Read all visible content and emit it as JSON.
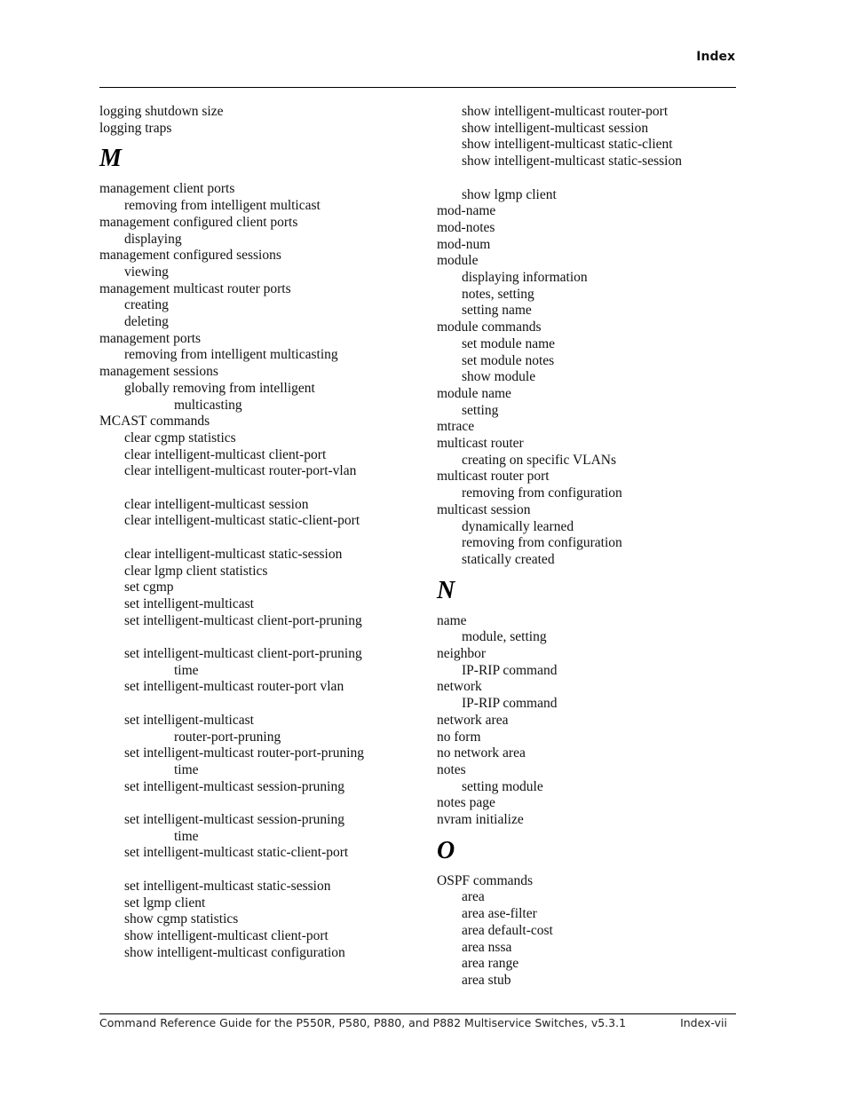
{
  "header": {
    "section_title": "Index"
  },
  "footer": {
    "guide_title": "Command Reference Guide for the P550R, P580, P880, and P882 Multiservice Switches, v5.3.1",
    "page_number": "Index-vii"
  },
  "left_column": [
    {
      "type": "entry",
      "level": 0,
      "text": "logging shutdown size"
    },
    {
      "type": "entry",
      "level": 0,
      "text": "logging traps"
    },
    {
      "type": "letter",
      "text": "M"
    },
    {
      "type": "entry",
      "level": 0,
      "text": "management client ports"
    },
    {
      "type": "entry",
      "level": 1,
      "text": "removing from intelligent multicast"
    },
    {
      "type": "entry",
      "level": 0,
      "text": "management configured client ports"
    },
    {
      "type": "entry",
      "level": 1,
      "text": "displaying"
    },
    {
      "type": "entry",
      "level": 0,
      "text": "management configured sessions"
    },
    {
      "type": "entry",
      "level": 1,
      "text": "viewing"
    },
    {
      "type": "entry",
      "level": 0,
      "text": "management multicast router ports"
    },
    {
      "type": "entry",
      "level": 1,
      "text": "creating"
    },
    {
      "type": "entry",
      "level": 1,
      "text": "deleting"
    },
    {
      "type": "entry",
      "level": 0,
      "text": "management ports"
    },
    {
      "type": "entry",
      "level": 1,
      "text": "removing from intelligent multicasting"
    },
    {
      "type": "entry",
      "level": 0,
      "text": "management sessions"
    },
    {
      "type": "entry",
      "level": 1,
      "text": "globally removing from intelligent"
    },
    {
      "type": "entry",
      "level": 2,
      "text": "multicasting"
    },
    {
      "type": "entry",
      "level": 0,
      "text": "MCAST commands"
    },
    {
      "type": "entry",
      "level": 1,
      "text": "clear cgmp statistics"
    },
    {
      "type": "entry",
      "level": 1,
      "text": "clear intelligent-multicast client-port"
    },
    {
      "type": "entry",
      "level": 1,
      "text": "clear intelligent-multicast router-port-vlan"
    },
    {
      "type": "blank"
    },
    {
      "type": "entry",
      "level": 1,
      "text": "clear intelligent-multicast session"
    },
    {
      "type": "entry",
      "level": 1,
      "text": "clear intelligent-multicast static-client-port"
    },
    {
      "type": "blank"
    },
    {
      "type": "entry",
      "level": 1,
      "text": "clear intelligent-multicast static-session"
    },
    {
      "type": "entry",
      "level": 1,
      "text": "clear lgmp client statistics"
    },
    {
      "type": "entry",
      "level": 1,
      "text": "set cgmp"
    },
    {
      "type": "entry",
      "level": 1,
      "text": "set intelligent-multicast"
    },
    {
      "type": "entry",
      "level": 1,
      "text": "set intelligent-multicast client-port-pruning"
    },
    {
      "type": "blank"
    },
    {
      "type": "entry",
      "level": 1,
      "text": "set intelligent-multicast client-port-pruning"
    },
    {
      "type": "entry",
      "level": 2,
      "text": "time"
    },
    {
      "type": "entry",
      "level": 1,
      "text": "set intelligent-multicast router-port vlan"
    },
    {
      "type": "blank"
    },
    {
      "type": "entry",
      "level": 1,
      "text": "set intelligent-multicast"
    },
    {
      "type": "entry",
      "level": 2,
      "text": "router-port-pruning"
    },
    {
      "type": "entry",
      "level": 1,
      "text": "set intelligent-multicast router-port-pruning"
    },
    {
      "type": "entry",
      "level": 2,
      "text": "time"
    },
    {
      "type": "entry",
      "level": 1,
      "text": "set intelligent-multicast session-pruning"
    },
    {
      "type": "blank"
    },
    {
      "type": "entry",
      "level": 1,
      "text": "set intelligent-multicast session-pruning"
    },
    {
      "type": "entry",
      "level": 2,
      "text": "time"
    },
    {
      "type": "entry",
      "level": 1,
      "text": "set intelligent-multicast static-client-port"
    },
    {
      "type": "blank"
    },
    {
      "type": "entry",
      "level": 1,
      "text": "set intelligent-multicast static-session"
    },
    {
      "type": "entry",
      "level": 1,
      "text": "set lgmp client"
    },
    {
      "type": "entry",
      "level": 1,
      "text": "show cgmp statistics"
    },
    {
      "type": "entry",
      "level": 1,
      "text": "show intelligent-multicast client-port"
    },
    {
      "type": "entry",
      "level": 1,
      "text": "show intelligent-multicast configuration"
    }
  ],
  "right_column": [
    {
      "type": "entry",
      "level": 1,
      "text": "show intelligent-multicast router-port"
    },
    {
      "type": "entry",
      "level": 1,
      "text": "show intelligent-multicast session"
    },
    {
      "type": "entry",
      "level": 1,
      "text": "show intelligent-multicast static-client"
    },
    {
      "type": "entry",
      "level": 1,
      "text": "show intelligent-multicast static-session"
    },
    {
      "type": "blank"
    },
    {
      "type": "entry",
      "level": 1,
      "text": "show lgmp client"
    },
    {
      "type": "entry",
      "level": 0,
      "text": "mod-name"
    },
    {
      "type": "entry",
      "level": 0,
      "text": "mod-notes"
    },
    {
      "type": "entry",
      "level": 0,
      "text": "mod-num"
    },
    {
      "type": "entry",
      "level": 0,
      "text": "module"
    },
    {
      "type": "entry",
      "level": 1,
      "text": "displaying information"
    },
    {
      "type": "entry",
      "level": 1,
      "text": "notes, setting"
    },
    {
      "type": "entry",
      "level": 1,
      "text": "setting name"
    },
    {
      "type": "entry",
      "level": 0,
      "text": "module commands"
    },
    {
      "type": "entry",
      "level": 1,
      "text": "set module name"
    },
    {
      "type": "entry",
      "level": 1,
      "text": "set module notes"
    },
    {
      "type": "entry",
      "level": 1,
      "text": "show module"
    },
    {
      "type": "entry",
      "level": 0,
      "text": "module name"
    },
    {
      "type": "entry",
      "level": 1,
      "text": "setting"
    },
    {
      "type": "entry",
      "level": 0,
      "text": "mtrace"
    },
    {
      "type": "entry",
      "level": 0,
      "text": "multicast router"
    },
    {
      "type": "entry",
      "level": 1,
      "text": "creating on specific VLANs"
    },
    {
      "type": "entry",
      "level": 0,
      "text": "multicast router port"
    },
    {
      "type": "entry",
      "level": 1,
      "text": "removing from configuration"
    },
    {
      "type": "entry",
      "level": 0,
      "text": "multicast session"
    },
    {
      "type": "entry",
      "level": 1,
      "text": "dynamically learned"
    },
    {
      "type": "entry",
      "level": 1,
      "text": "removing from configuration"
    },
    {
      "type": "entry",
      "level": 1,
      "text": "statically created"
    },
    {
      "type": "letter",
      "text": "N"
    },
    {
      "type": "entry",
      "level": 0,
      "text": "name"
    },
    {
      "type": "entry",
      "level": 1,
      "text": "module, setting"
    },
    {
      "type": "entry",
      "level": 0,
      "text": "neighbor"
    },
    {
      "type": "entry",
      "level": 1,
      "text": "IP-RIP command"
    },
    {
      "type": "entry",
      "level": 0,
      "text": "network"
    },
    {
      "type": "entry",
      "level": 1,
      "text": "IP-RIP command"
    },
    {
      "type": "entry",
      "level": 0,
      "text": "network area"
    },
    {
      "type": "entry",
      "level": 0,
      "text": "no form"
    },
    {
      "type": "entry",
      "level": 0,
      "text": "no network area"
    },
    {
      "type": "entry",
      "level": 0,
      "text": "notes"
    },
    {
      "type": "entry",
      "level": 1,
      "text": "setting module"
    },
    {
      "type": "entry",
      "level": 0,
      "text": "notes page"
    },
    {
      "type": "entry",
      "level": 0,
      "text": "nvram initialize"
    },
    {
      "type": "letter",
      "text": "O"
    },
    {
      "type": "entry",
      "level": 0,
      "text": "OSPF commands"
    },
    {
      "type": "entry",
      "level": 1,
      "text": "area"
    },
    {
      "type": "entry",
      "level": 1,
      "text": "area ase-filter"
    },
    {
      "type": "entry",
      "level": 1,
      "text": "area default-cost"
    },
    {
      "type": "entry",
      "level": 1,
      "text": "area nssa"
    },
    {
      "type": "entry",
      "level": 1,
      "text": "area range"
    },
    {
      "type": "entry",
      "level": 1,
      "text": "area stub"
    }
  ]
}
